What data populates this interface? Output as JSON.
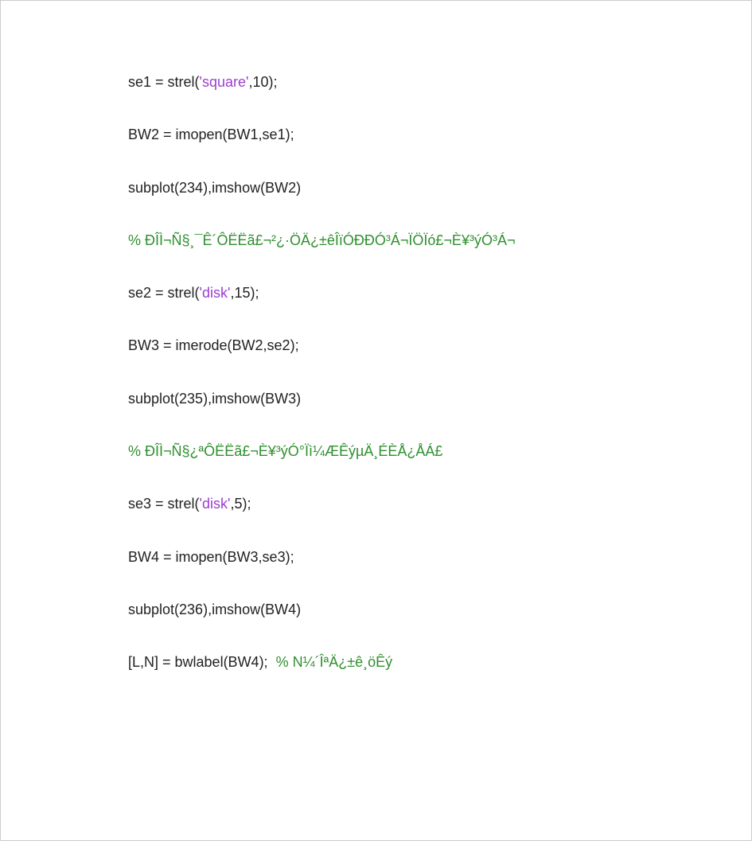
{
  "lines": [
    {
      "segments": [
        {
          "cls": "code",
          "t": "se1 = strel("
        },
        {
          "cls": "str",
          "t": "'square'"
        },
        {
          "cls": "code",
          "t": ",10);"
        }
      ]
    },
    {
      "segments": [
        {
          "cls": "code",
          "t": "BW2 = imopen(BW1,se1);"
        }
      ]
    },
    {
      "segments": [
        {
          "cls": "code",
          "t": "subplot(234),imshow(BW2)"
        }
      ]
    },
    {
      "segments": [
        {
          "cls": "cmt",
          "t": "% ÐÎÌ¬Ñ§¸¯Ê´ÔËËã£¬²¿·ÖÄ¿±êÎïÓÐÐÓ³Á¬ÏÖÏó£¬È¥³ýÓ³Á¬"
        }
      ]
    },
    {
      "segments": [
        {
          "cls": "code",
          "t": "se2 = strel("
        },
        {
          "cls": "str",
          "t": "'disk'"
        },
        {
          "cls": "code",
          "t": ",15);"
        }
      ]
    },
    {
      "segments": [
        {
          "cls": "code",
          "t": "BW3 = imerode(BW2,se2);"
        }
      ]
    },
    {
      "segments": [
        {
          "cls": "code",
          "t": "subplot(235),imshow(BW3)"
        }
      ]
    },
    {
      "segments": [
        {
          "cls": "cmt",
          "t": "% ÐÎÌ¬Ñ§¿ªÔËËã£¬È¥³ýÓ°Ïì¼ÆÊýµÄ¸ÉÈÅ¿ÅÁ£"
        }
      ]
    },
    {
      "segments": [
        {
          "cls": "code",
          "t": "se3 = strel("
        },
        {
          "cls": "str",
          "t": "'disk'"
        },
        {
          "cls": "code",
          "t": ",5);"
        }
      ]
    },
    {
      "segments": [
        {
          "cls": "code",
          "t": "BW4 = imopen(BW3,se3);"
        }
      ]
    },
    {
      "segments": [
        {
          "cls": "code",
          "t": "subplot(236),imshow(BW4)"
        }
      ]
    },
    {
      "segments": [
        {
          "cls": "code",
          "t": "[L,N] = bwlabel(BW4);  "
        },
        {
          "cls": "cmt",
          "t": "% N¼´ÎªÄ¿±ê¸öÊý"
        }
      ]
    }
  ]
}
